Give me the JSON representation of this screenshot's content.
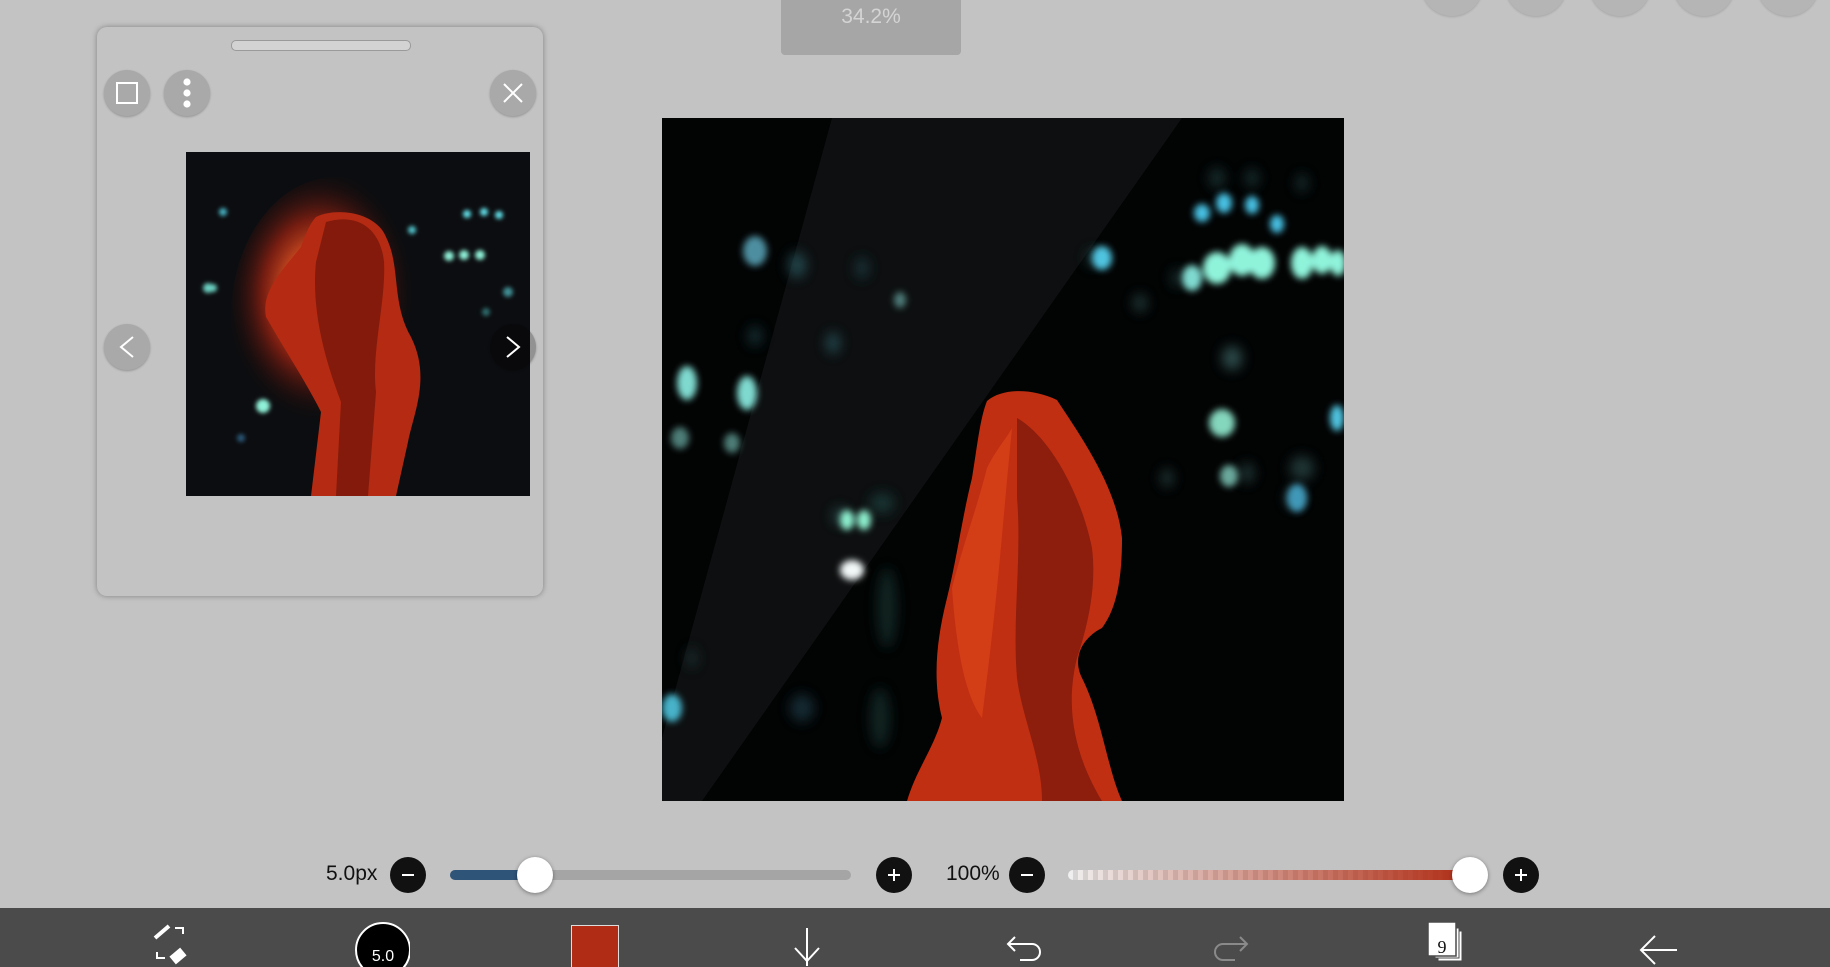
{
  "zoom": {
    "text": "34.2%"
  },
  "top_toolbar": {
    "icons": [
      "menu-icon",
      "selection-icon",
      "layer-icon",
      "pen-icon",
      "canvas-icon"
    ]
  },
  "reference_panel": {
    "icons": {
      "frame": "square-frame-icon",
      "more": "more-vertical-icon",
      "close": "close-icon",
      "prev": "chevron-left-icon",
      "next": "chevron-right-icon"
    }
  },
  "brush_size": {
    "text": "5.0px",
    "value": 5.0,
    "max": 100
  },
  "opacity": {
    "text": "100%",
    "value": 100
  },
  "colors": {
    "accent_blue": "#2e5478",
    "brush_color": "#b02c14",
    "toolbar_bg": "#4b4b4b",
    "workspace_bg": "#c3c3c3"
  },
  "bottom_toolbar": {
    "brush_preview_value": "5.0",
    "layers_count": "9",
    "icons": [
      "brush-eraser-swap-icon",
      "brush-size-icon",
      "color-icon",
      "download-icon",
      "undo-icon",
      "redo-icon",
      "layers-icon",
      "back-arrow-icon"
    ]
  }
}
